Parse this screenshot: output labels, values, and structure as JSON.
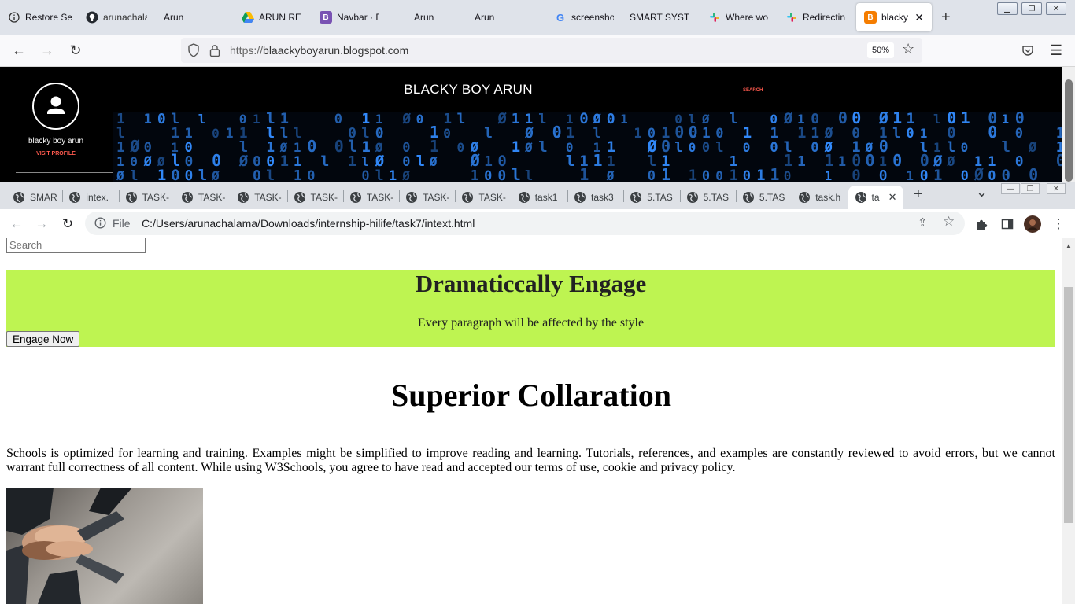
{
  "firefox": {
    "tabs": [
      {
        "label": "Restore Se",
        "icon": "info-icon"
      },
      {
        "label": "arunachala",
        "icon": "github-icon"
      },
      {
        "label": "Arun",
        "icon": "blank-icon"
      },
      {
        "label": "ARUN RES",
        "icon": "google-drive-icon"
      },
      {
        "label": "Navbar · B",
        "icon": "bootstrap-icon"
      },
      {
        "label": "Arun",
        "icon": "blank-icon"
      },
      {
        "label": "Arun",
        "icon": "blank-icon"
      },
      {
        "label": "screenshot",
        "icon": "google-icon"
      },
      {
        "label": "SMART SYSTE",
        "icon": "blank-icon"
      },
      {
        "label": "Where wor",
        "icon": "slack-icon"
      },
      {
        "label": "Redirecting",
        "icon": "slack-icon"
      },
      {
        "label": "blacky b",
        "icon": "blogger-icon"
      }
    ],
    "url_prefix": "https://",
    "url_host": "blaackyboyarun.blogspot.com",
    "zoom": "50%"
  },
  "blog": {
    "title": "BLACKY BOY ARUN",
    "search_label": "SEARCH",
    "profile_name": "blacky boy arun",
    "visit_profile": "VISIT PROFILE"
  },
  "chrome": {
    "tabs": [
      "SMAR",
      "intex.",
      "TASK-",
      "TASK-",
      "TASK-",
      "TASK-",
      "TASK-",
      "TASK-",
      "TASK-",
      "task1",
      "task3",
      "5.TAS",
      "5.TAS",
      "5.TAS",
      "task.h",
      "ta"
    ],
    "scheme_label": "File",
    "url": "C:/Users/arunachalama/Downloads/internship-hilife/task7/intext.html"
  },
  "page": {
    "search_placeholder": "Search",
    "hero_title": "Dramaticcally Engage",
    "hero_text": "Every paragraph will be affected by the style",
    "engage_button": "Engage Now",
    "section_title": "Superior Collaration",
    "paragraph": "Schools is optimized for learning and training. Examples might be simplified to improve reading and learning. Tutorials, references, and examples are constantly reviewed to avoid errors, but we cannot warrant full correctness of all content. While using W3Schools, you agree to have read and accepted our terms of use, cookie and privacy policy."
  },
  "colors": {
    "hero_bg": "#bef451",
    "blogger_orange": "#f57d00",
    "matrix_blue": "#2a8cf0"
  }
}
